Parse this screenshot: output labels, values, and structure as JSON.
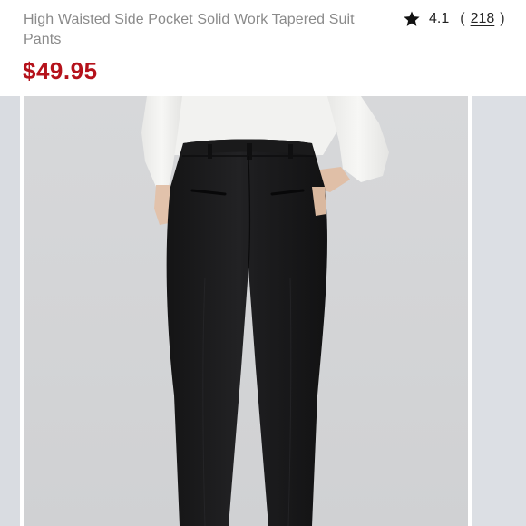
{
  "product": {
    "title": "High Waisted Side Pocket Solid Work Tapered Suit Pants",
    "price": "$49.95",
    "rating": {
      "value": "4.1",
      "open_paren": "(",
      "count": "218",
      "close_paren": ")",
      "icon": "star-icon"
    },
    "image": {
      "subject": "model-back-view-black-tapered-pants"
    }
  },
  "colors": {
    "price": "#b5121b",
    "title": "#8a8a8a",
    "photo_background": "#d4d5d7",
    "pants": "#1c1c1d",
    "top": "#f3f3f1"
  }
}
